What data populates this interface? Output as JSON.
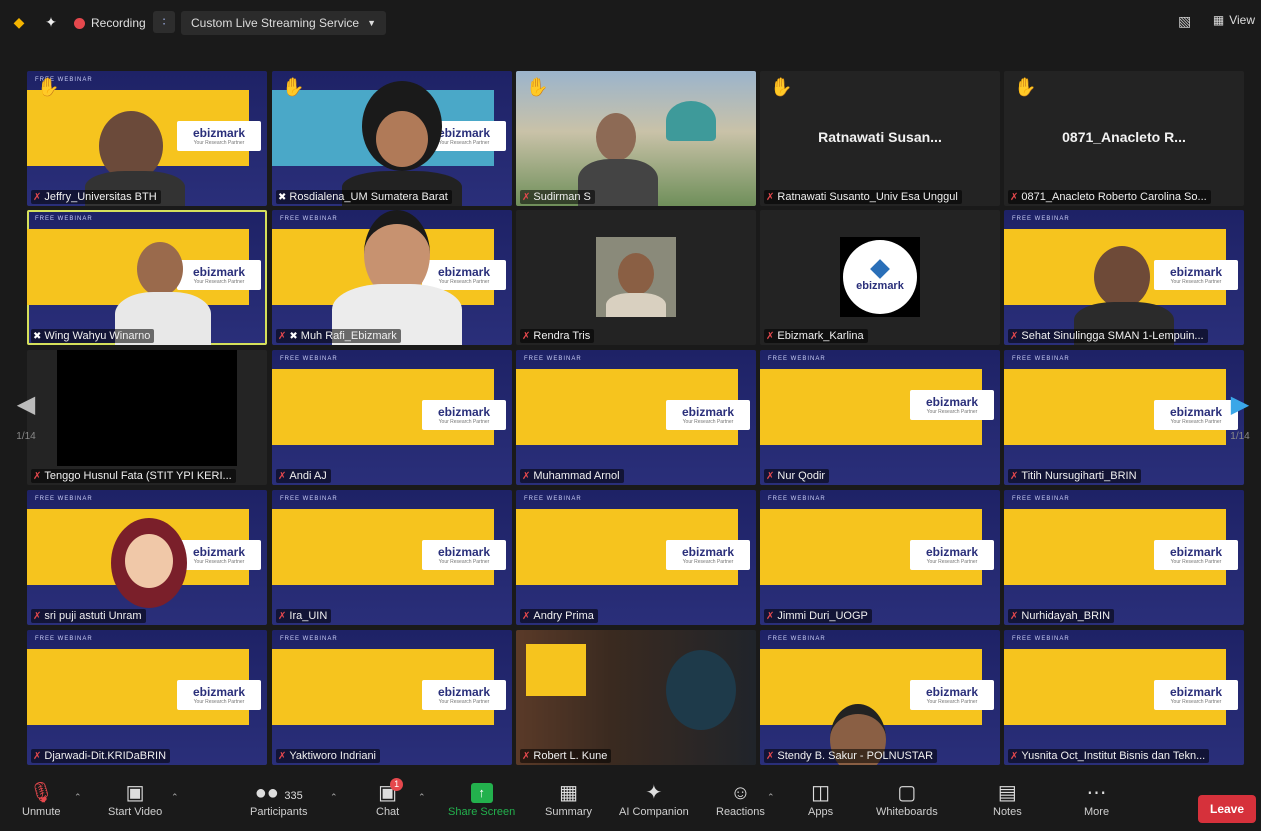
{
  "topbar": {
    "recording_label": "Recording",
    "stream_label": "Custom Live Streaming Service",
    "view_label": "View",
    "icons": [
      "shield-icon",
      "sparkle-icon",
      "record-dot-icon",
      "live-stream-icon",
      "layout-icon",
      "grid-view-icon"
    ]
  },
  "slide": {
    "strip": "FREE WEBINAR",
    "logo": "ebizmark",
    "tagline": "Your Research Partner"
  },
  "tiles": [
    {
      "name": "Jeffry_Universitas BTH",
      "type": "slide",
      "hand": true
    },
    {
      "name": "Rosdialena_UM Sumatera Barat",
      "type": "slide",
      "hand": true,
      "pinned": true
    },
    {
      "name": "Sudirman S",
      "type": "photo",
      "hand": true
    },
    {
      "name": "Ratnawati Susanto_Univ Esa Unggul",
      "type": "namecard",
      "bigname": "Ratnawati  Susan...",
      "hand": true
    },
    {
      "name": "0871_Anacleto Roberto Carolina So...",
      "type": "namecard",
      "bigname": "0871_Anacleto  R...",
      "hand": true
    },
    {
      "name": "Wing Wahyu Winarno",
      "type": "slide",
      "pinned": true,
      "active": true
    },
    {
      "name": "Muh Rafi_Ebizmark",
      "type": "slide",
      "pinned": true
    },
    {
      "name": "Rendra Tris",
      "type": "avatar-photo"
    },
    {
      "name": "Ebizmark_Karlina",
      "type": "logo"
    },
    {
      "name": "Sehat Sinulingga SMAN 1-Lempuin...",
      "type": "slide"
    },
    {
      "name": "Tenggo Husnul Fata (STIT YPI KERI...",
      "type": "black"
    },
    {
      "name": "Andi AJ",
      "type": "slide"
    },
    {
      "name": "Muhammad Arnol",
      "type": "slide"
    },
    {
      "name": "Nur Qodir",
      "type": "slide"
    },
    {
      "name": "Titih Nursugiharti_BRIN",
      "type": "slide"
    },
    {
      "name": "sri puji astuti Unram",
      "type": "slide"
    },
    {
      "name": "Ira_UIN",
      "type": "slide"
    },
    {
      "name": "Andry Prima",
      "type": "slide"
    },
    {
      "name": "Jimmi Duri_UOGP",
      "type": "slide"
    },
    {
      "name": "Nurhidayah_BRIN",
      "type": "slide"
    },
    {
      "name": "Djarwadi-Dit.KRIDaBRIN",
      "type": "slide"
    },
    {
      "name": "Yaktiworo Indriani",
      "type": "slide"
    },
    {
      "name": "Robert L. Kune",
      "type": "photo2"
    },
    {
      "name": "Stendy B. Sakur - POLNUSTAR",
      "type": "slide"
    },
    {
      "name": "Yusnita Oct_Institut Bisnis dan Tekn...",
      "type": "slide"
    }
  ],
  "pager": {
    "left": "1/14",
    "right": "1/14"
  },
  "toolbar": {
    "unmute": "Unmute",
    "start_video": "Start Video",
    "participants": "Participants",
    "participants_count": "335",
    "chat": "Chat",
    "chat_badge": "1",
    "share": "Share Screen",
    "summary": "Summary",
    "ai": "AI Companion",
    "reactions": "Reactions",
    "apps": "Apps",
    "whiteboards": "Whiteboards",
    "notes": "Notes",
    "more": "More",
    "leave": "Leave"
  },
  "colors": {
    "share_green": "#23b14d",
    "leave_red": "#d6313b",
    "slide_yellow": "#f6c41e",
    "slide_navy": "#2a2f7a",
    "hand": "#f4b400",
    "active_border": "#d5e05b"
  }
}
